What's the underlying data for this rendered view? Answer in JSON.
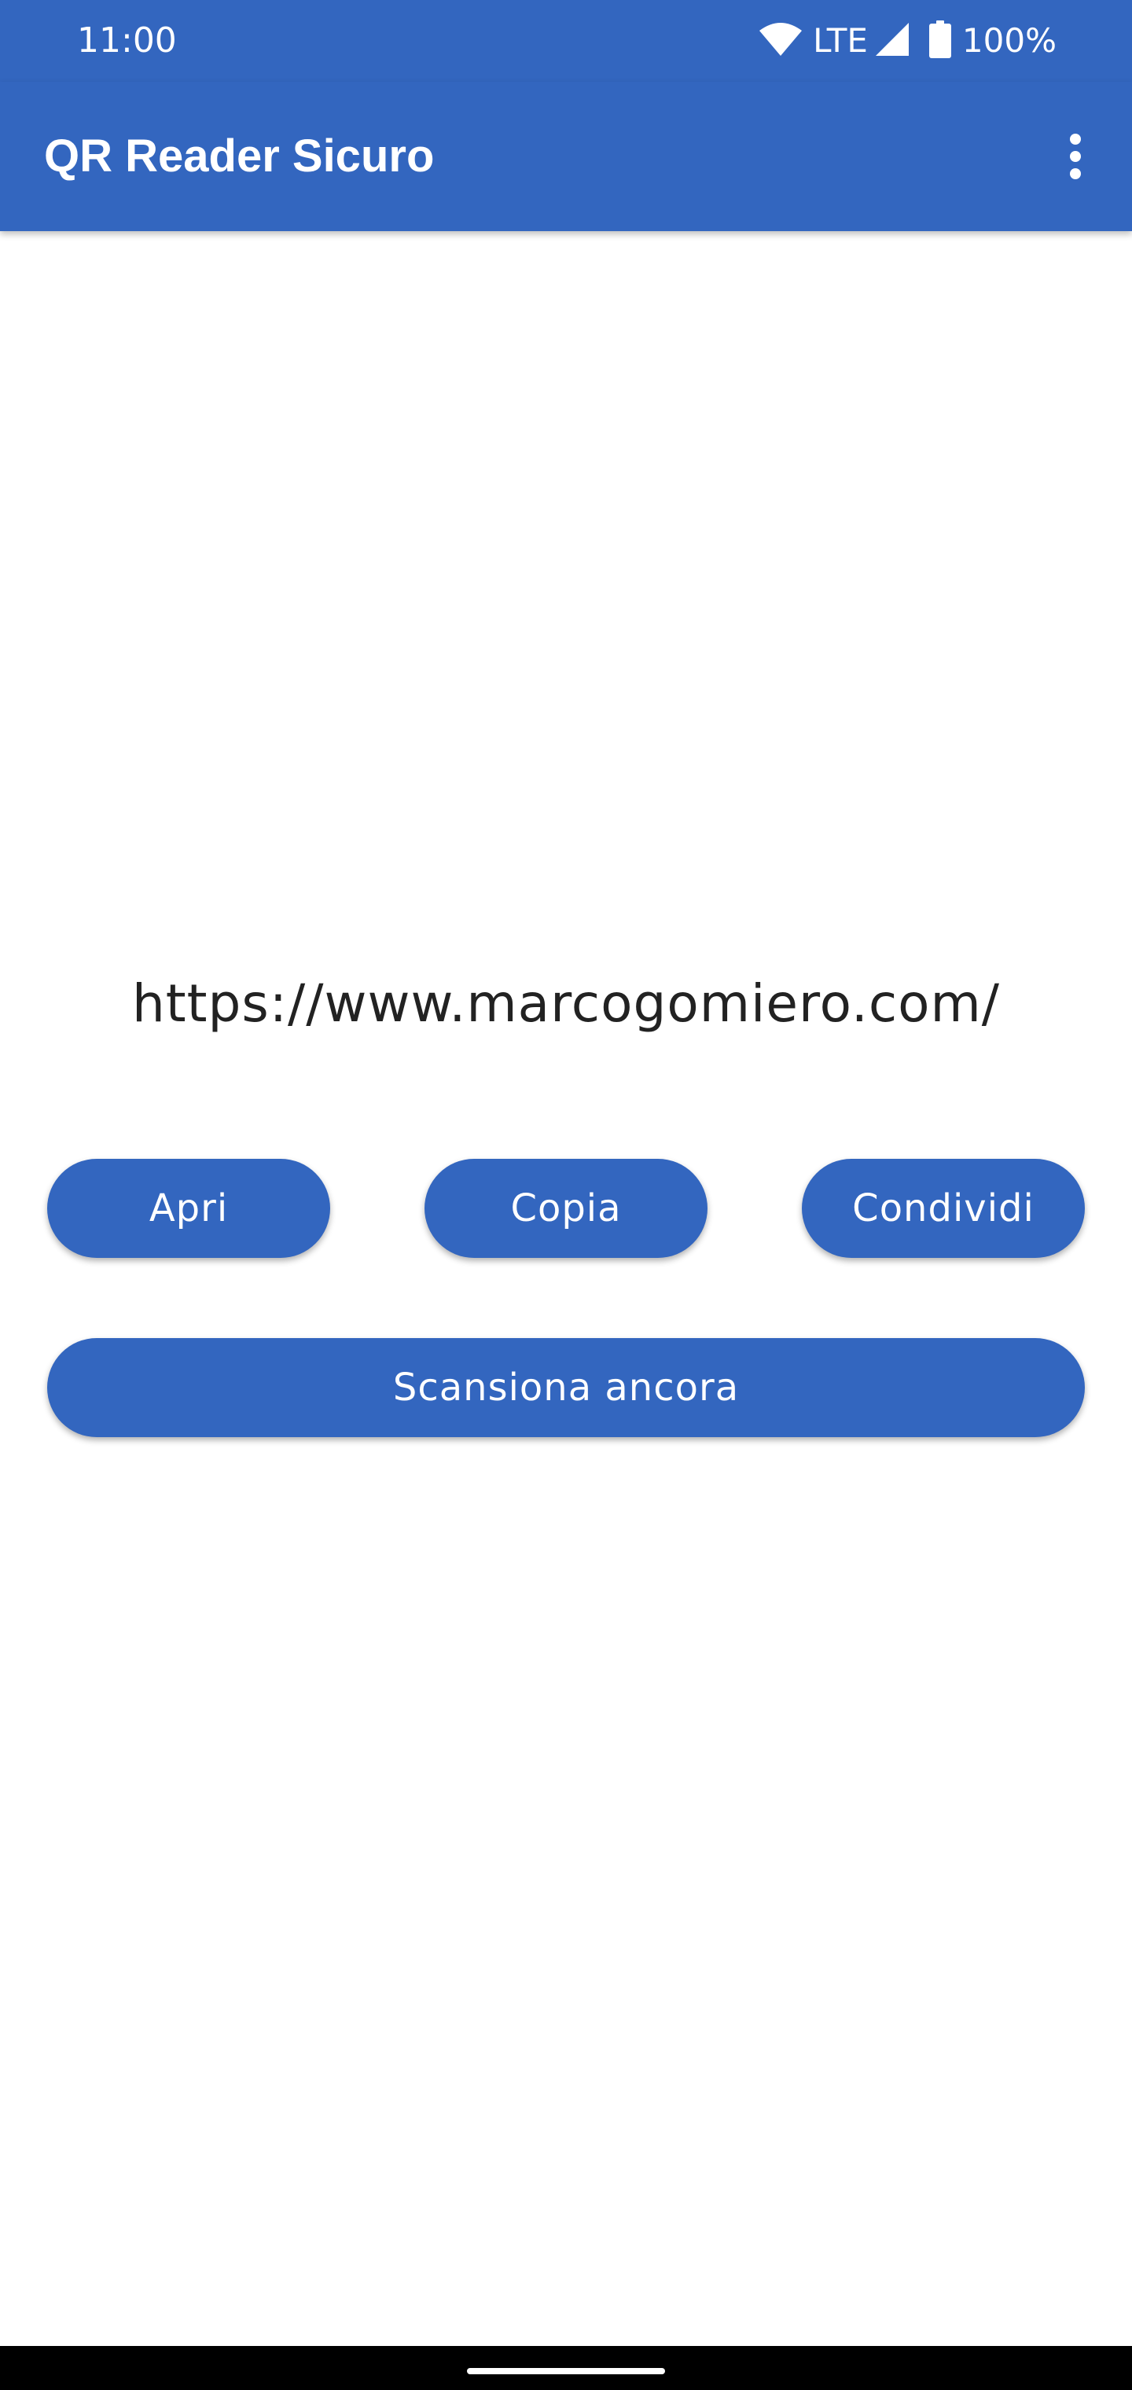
{
  "status_bar": {
    "time": "11:00",
    "network": "LTE",
    "battery": "100%",
    "icons": [
      "wifi-icon",
      "signal-icon",
      "battery-icon"
    ]
  },
  "app_bar": {
    "title": "QR Reader Sicuro",
    "menu_icon": "more-vert-icon",
    "color": "#3366bf"
  },
  "result": {
    "text": "https://www.marcogomiero.com/"
  },
  "actions": {
    "open": "Apri",
    "copy": "Copia",
    "share": "Condividi",
    "scan_again": "Scansiona ancora"
  }
}
